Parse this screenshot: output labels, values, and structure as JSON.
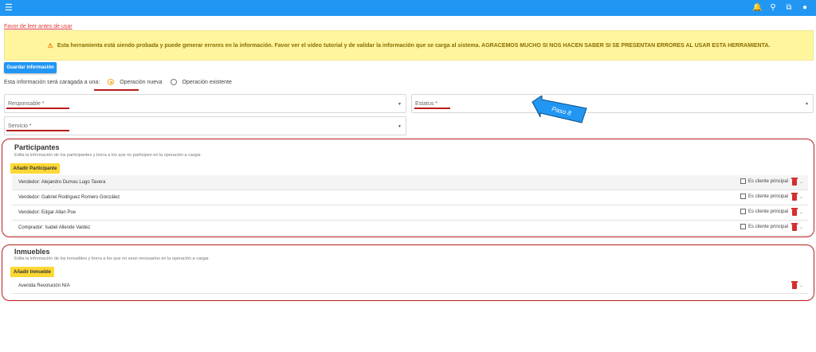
{
  "topbar": {
    "menu_icon": "hamburger-menu-icon",
    "icons": [
      "bell-icon",
      "search-icon",
      "copy-icon",
      "user-icon"
    ]
  },
  "warning": {
    "link": "Favor de leer antes de usar",
    "message": "Esta herramienta está siendo probada y puede generar errores en la información. Favor ver el video tutorial y de validar la información que se carga al sistema. AGRACEMOS MUCHO SI NOS HACEN SABER SI SE PRESENTAN ERRORES AL USAR ESTA HERRAMIENTA.",
    "icon": "warning-icon"
  },
  "save_label": "Guardar información",
  "operation": {
    "prompt": "Esta información será caragada a una:",
    "options": [
      "Operación nueva",
      "Operación existente"
    ],
    "selected": "Operación nueva"
  },
  "fields": {
    "responsable": "Responsable *",
    "estatus": "Estatus *",
    "servicio": "Servicio *"
  },
  "callout": {
    "label": "Paso 8",
    "color": "#2196f3"
  },
  "participantes": {
    "title": "Participantes",
    "subtitle": "Edita la información de los participantes y borra a los que no participen en la operación a cargar.",
    "add_label": "Añadir Participante",
    "checkbox_label": "Es cliente principal",
    "rows": [
      "Vendedor: Alejandro Dumas Lugo Tavera",
      "Vendedor: Gabriel Rodriguez Romero González",
      "Vendedor: Edgar Allan Poe",
      "Comprador: Isabel Allende Valdez"
    ]
  },
  "inmuebles": {
    "title": "Inmuebles",
    "subtitle": "Edita la información de los inmuebles y borra a los que no sean necesarios en la operación a cargar.",
    "add_label": "Añadir Inmueble",
    "rows": [
      "Avenida Revolución N/A"
    ]
  },
  "colors": {
    "primary": "#2196f3",
    "accent": "#fdd835",
    "highlight": "#b71c1c",
    "warning_bg": "#fff59d"
  }
}
